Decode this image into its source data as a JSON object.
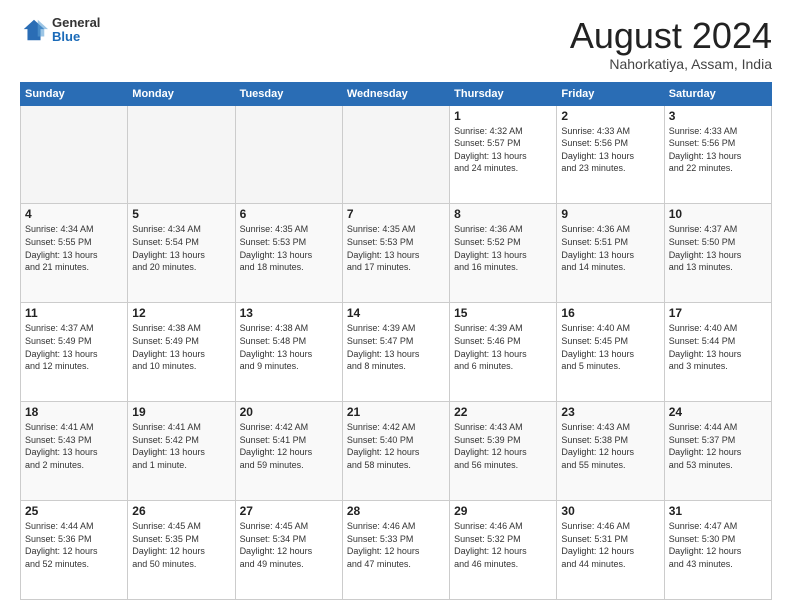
{
  "header": {
    "logo_general": "General",
    "logo_blue": "Blue",
    "month_title": "August 2024",
    "location": "Nahorkatiya, Assam, India"
  },
  "days_of_week": [
    "Sunday",
    "Monday",
    "Tuesday",
    "Wednesday",
    "Thursday",
    "Friday",
    "Saturday"
  ],
  "weeks": [
    [
      {
        "num": "",
        "info": ""
      },
      {
        "num": "",
        "info": ""
      },
      {
        "num": "",
        "info": ""
      },
      {
        "num": "",
        "info": ""
      },
      {
        "num": "1",
        "info": "Sunrise: 4:32 AM\nSunset: 5:57 PM\nDaylight: 13 hours\nand 24 minutes."
      },
      {
        "num": "2",
        "info": "Sunrise: 4:33 AM\nSunset: 5:56 PM\nDaylight: 13 hours\nand 23 minutes."
      },
      {
        "num": "3",
        "info": "Sunrise: 4:33 AM\nSunset: 5:56 PM\nDaylight: 13 hours\nand 22 minutes."
      }
    ],
    [
      {
        "num": "4",
        "info": "Sunrise: 4:34 AM\nSunset: 5:55 PM\nDaylight: 13 hours\nand 21 minutes."
      },
      {
        "num": "5",
        "info": "Sunrise: 4:34 AM\nSunset: 5:54 PM\nDaylight: 13 hours\nand 20 minutes."
      },
      {
        "num": "6",
        "info": "Sunrise: 4:35 AM\nSunset: 5:53 PM\nDaylight: 13 hours\nand 18 minutes."
      },
      {
        "num": "7",
        "info": "Sunrise: 4:35 AM\nSunset: 5:53 PM\nDaylight: 13 hours\nand 17 minutes."
      },
      {
        "num": "8",
        "info": "Sunrise: 4:36 AM\nSunset: 5:52 PM\nDaylight: 13 hours\nand 16 minutes."
      },
      {
        "num": "9",
        "info": "Sunrise: 4:36 AM\nSunset: 5:51 PM\nDaylight: 13 hours\nand 14 minutes."
      },
      {
        "num": "10",
        "info": "Sunrise: 4:37 AM\nSunset: 5:50 PM\nDaylight: 13 hours\nand 13 minutes."
      }
    ],
    [
      {
        "num": "11",
        "info": "Sunrise: 4:37 AM\nSunset: 5:49 PM\nDaylight: 13 hours\nand 12 minutes."
      },
      {
        "num": "12",
        "info": "Sunrise: 4:38 AM\nSunset: 5:49 PM\nDaylight: 13 hours\nand 10 minutes."
      },
      {
        "num": "13",
        "info": "Sunrise: 4:38 AM\nSunset: 5:48 PM\nDaylight: 13 hours\nand 9 minutes."
      },
      {
        "num": "14",
        "info": "Sunrise: 4:39 AM\nSunset: 5:47 PM\nDaylight: 13 hours\nand 8 minutes."
      },
      {
        "num": "15",
        "info": "Sunrise: 4:39 AM\nSunset: 5:46 PM\nDaylight: 13 hours\nand 6 minutes."
      },
      {
        "num": "16",
        "info": "Sunrise: 4:40 AM\nSunset: 5:45 PM\nDaylight: 13 hours\nand 5 minutes."
      },
      {
        "num": "17",
        "info": "Sunrise: 4:40 AM\nSunset: 5:44 PM\nDaylight: 13 hours\nand 3 minutes."
      }
    ],
    [
      {
        "num": "18",
        "info": "Sunrise: 4:41 AM\nSunset: 5:43 PM\nDaylight: 13 hours\nand 2 minutes."
      },
      {
        "num": "19",
        "info": "Sunrise: 4:41 AM\nSunset: 5:42 PM\nDaylight: 13 hours\nand 1 minute."
      },
      {
        "num": "20",
        "info": "Sunrise: 4:42 AM\nSunset: 5:41 PM\nDaylight: 12 hours\nand 59 minutes."
      },
      {
        "num": "21",
        "info": "Sunrise: 4:42 AM\nSunset: 5:40 PM\nDaylight: 12 hours\nand 58 minutes."
      },
      {
        "num": "22",
        "info": "Sunrise: 4:43 AM\nSunset: 5:39 PM\nDaylight: 12 hours\nand 56 minutes."
      },
      {
        "num": "23",
        "info": "Sunrise: 4:43 AM\nSunset: 5:38 PM\nDaylight: 12 hours\nand 55 minutes."
      },
      {
        "num": "24",
        "info": "Sunrise: 4:44 AM\nSunset: 5:37 PM\nDaylight: 12 hours\nand 53 minutes."
      }
    ],
    [
      {
        "num": "25",
        "info": "Sunrise: 4:44 AM\nSunset: 5:36 PM\nDaylight: 12 hours\nand 52 minutes."
      },
      {
        "num": "26",
        "info": "Sunrise: 4:45 AM\nSunset: 5:35 PM\nDaylight: 12 hours\nand 50 minutes."
      },
      {
        "num": "27",
        "info": "Sunrise: 4:45 AM\nSunset: 5:34 PM\nDaylight: 12 hours\nand 49 minutes."
      },
      {
        "num": "28",
        "info": "Sunrise: 4:46 AM\nSunset: 5:33 PM\nDaylight: 12 hours\nand 47 minutes."
      },
      {
        "num": "29",
        "info": "Sunrise: 4:46 AM\nSunset: 5:32 PM\nDaylight: 12 hours\nand 46 minutes."
      },
      {
        "num": "30",
        "info": "Sunrise: 4:46 AM\nSunset: 5:31 PM\nDaylight: 12 hours\nand 44 minutes."
      },
      {
        "num": "31",
        "info": "Sunrise: 4:47 AM\nSunset: 5:30 PM\nDaylight: 12 hours\nand 43 minutes."
      }
    ]
  ]
}
